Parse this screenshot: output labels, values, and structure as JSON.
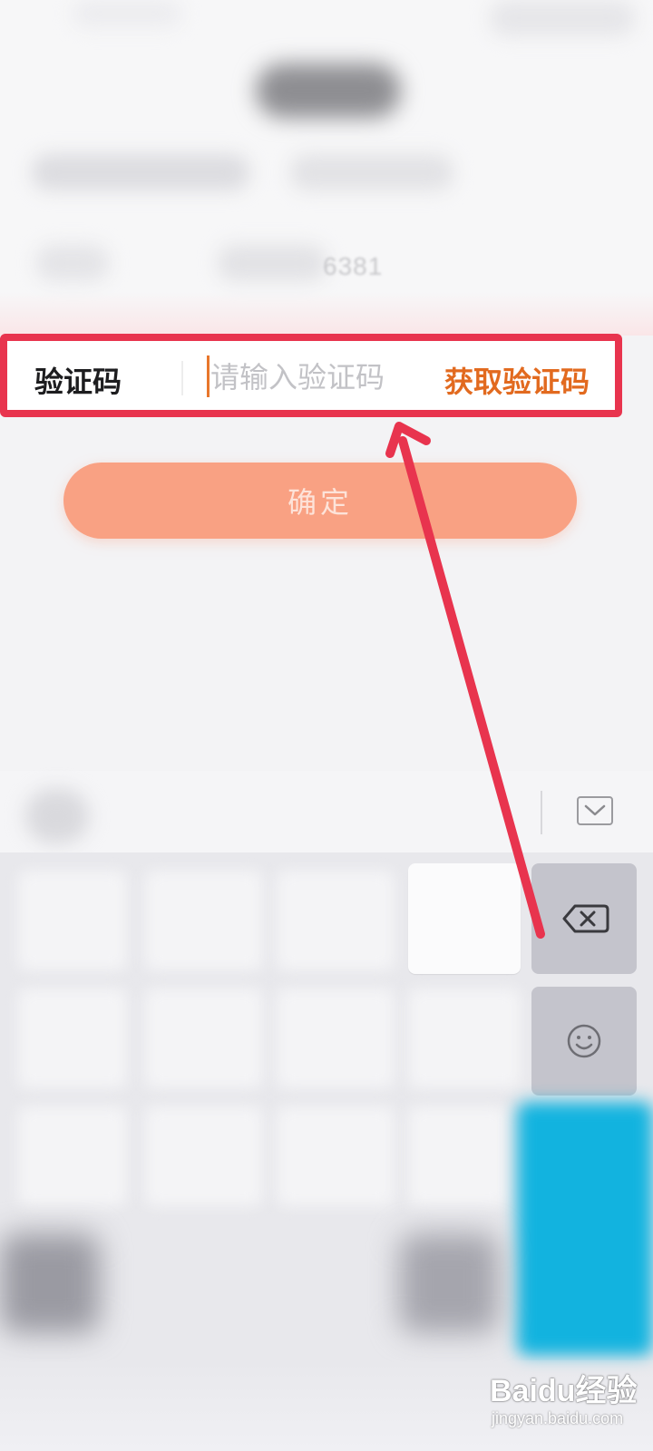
{
  "background_form": {
    "masked_phone_suffix": "6381"
  },
  "verification_row": {
    "label": "验证码",
    "input_placeholder": "请输入验证码",
    "input_value": "",
    "get_code_label": "获取验证码"
  },
  "confirm_button": {
    "label": "确定"
  },
  "keyboard": {
    "collapse_icon": "chevron-down-icon",
    "backspace_icon": "backspace-icon",
    "emoji_icon": "smiley-icon",
    "backspace_symbol": "⌫",
    "emoji_symbol": "☺"
  },
  "annotation": {
    "highlight_color": "#e8344e",
    "arrow_color": "#e8344e"
  },
  "watermark": {
    "brand_text": "Baidu经验",
    "sub_text": "jingyan.baidu.com"
  },
  "colors": {
    "accent_orange": "#e26a1f",
    "confirm_button_bg": "#f9a183"
  }
}
